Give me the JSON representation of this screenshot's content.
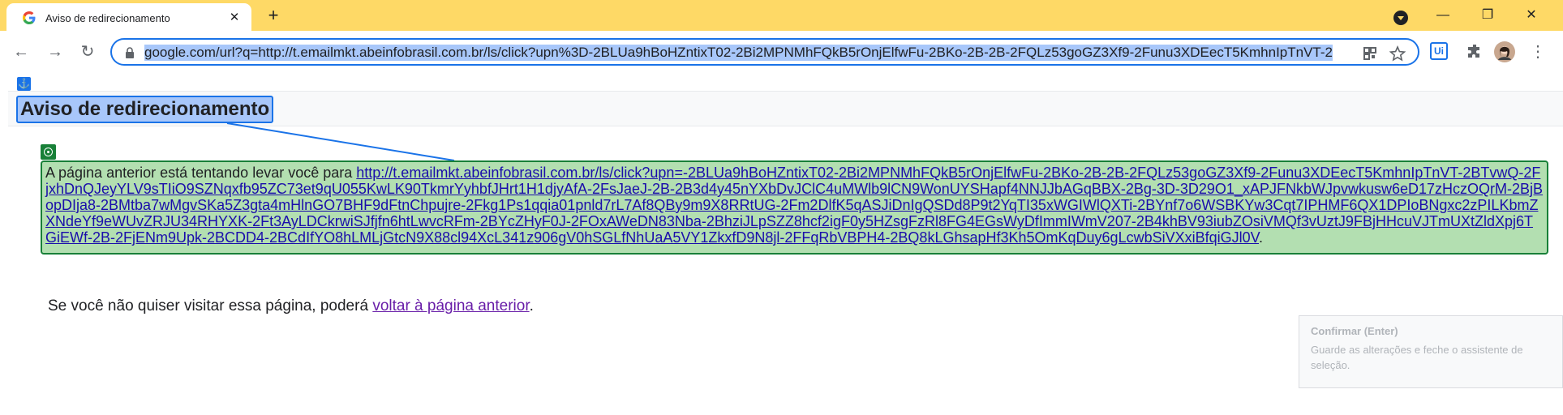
{
  "tab": {
    "title": "Aviso de redirecionamento",
    "favicon": "google-g-icon",
    "close_glyph": "✕",
    "new_tab_glyph": "+"
  },
  "window": {
    "minimize_glyph": "—",
    "maximize_glyph": "❐",
    "close_glyph": "✕"
  },
  "toolbar": {
    "back_glyph": "←",
    "forward_glyph": "→",
    "reload_glyph": "↻",
    "url": "google.com/url?q=http://t.emailmkt.abeinfobrasil.com.br/ls/click?upn%3D-2BLUa9hBoHZntixT02-2Bi2MPNMhFQkB5rOnjElfwFu-2BKo-2B-2B-2FQLz53goGZ3Xf9-2Funu3XDEecT5KmhnIpTnVT-2",
    "menu_glyph": "⋮",
    "extension_label": "Ui"
  },
  "page": {
    "heading": "Aviso de redirecionamento",
    "intro": "A página anterior está tentando levar você para",
    "redirect_link": "http://t.emailmkt.abeinfobrasil.com.br/ls/click?upn=-2BLUa9hBoHZntixT02-2Bi2MPNMhFQkB5rOnjElfwFu-2BKo-2B-2B-2FQLz53goGZ3Xf9-2Funu3XDEecT5KmhnIpTnVT-2BTvwQ-2FjxhDnQJeyYLV9sTIiO9SZNqxfb95ZC73et9qU055KwLK90TkmrYyhbfJHrt1H1djyAfA-2FsJaeJ-2B-2B3d4y45nYXbDvJClC4uMWlb9lCN9WonUYSHapf4NNJJbAGqBBX-2Bg-3D-3D29O1_xAPJFNkbWJpvwkusw6eD17zHczOQrM-2BjBopDIja8-2BMtba7wMgvSKa5Z3gta4mHlnGO7BHF9dFtnChpujre-2Fkg1Ps1qqia01pnld7rL7Af8QBy9m9X8RRtUG-2Fm2DlfK5qASJiDnIgQSDd8P9t2YqTI35xWGIWlQXTi-2BYnf7o6WSBKYw3Cqt7IPHMF6QX1DPIoBNgxc2zPILKbmZXNdeYf9eWUvZRJU34RHYXK-2Ft3AyLDCkrwiSJfjfn6htLwvcRFm-2BYcZHyF0J-2FOxAWeDN83Nba-2BhziJLpSZZ8hcf2igF0y5HZsgFzRl8FG4EGsWyDfImmIWmV207-2B4khBV93iubZOsiVMQf3vUztJ9FBjHHcuVJTmUXtZldXpj6TGiEWf-2B-2FjENm9Upk-2BCDD4-2BCdIfYO8hLMLjGtcN9X88cl94XcL341z906gV0hSGLfNhUaA5VY1ZkxfD9N8jl-2FFqRbVBPH4-2BQ8kLGhsapHf3Kh5OmKqDuy6gLcwbSiVXxiBfqiGJl0V",
    "intro_end": ".",
    "back_prefix": "Se você não quiser visitar essa página, poderá",
    "back_link": "voltar à página anterior",
    "back_suffix": "."
  },
  "tooltip": {
    "title": "Confirmar (Enter)",
    "body": "Guarde as alterações e feche o assistente de seleção."
  },
  "colors": {
    "title_bar": "#fed966",
    "selection_blue": "#1a73e8",
    "target_green": "#188038"
  }
}
